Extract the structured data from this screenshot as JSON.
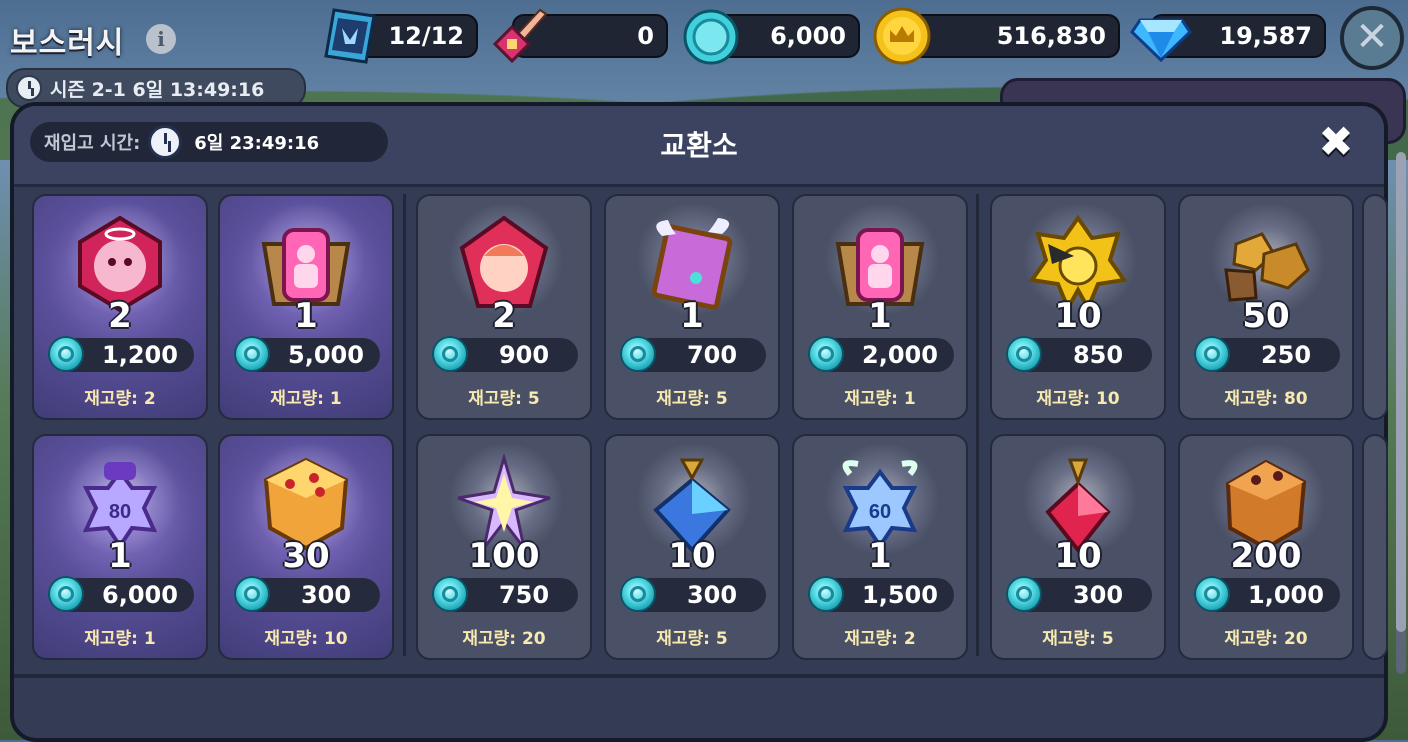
{
  "header": {
    "title": "보스러시",
    "season_text": "시즌 2-1  6일 13:49:16",
    "resources": [
      {
        "name": "ticket",
        "value": "12/12",
        "icon": "dragon-ticket-icon"
      },
      {
        "name": "sword",
        "value": "0",
        "icon": "sword-icon"
      },
      {
        "name": "boss-coin",
        "value": "6,000",
        "icon": "cyan-coin-icon"
      },
      {
        "name": "gold",
        "value": "516,830",
        "icon": "gold-crown-coin-icon"
      },
      {
        "name": "crystal",
        "value": "19,587",
        "icon": "diamond-icon"
      }
    ],
    "close_glyph": "✕"
  },
  "modal": {
    "restock_label": "재입고 시간:",
    "restock_time": "6일 23:49:16",
    "title": "교환소",
    "close_glyph": "✖"
  },
  "items": [
    {
      "icon": "pink-cookie-gem-icon",
      "qty": "2",
      "price": "1,200",
      "stock": "재고량: 2",
      "highlight": true
    },
    {
      "icon": "cookie-soulstone-chest-icon",
      "qty": "1",
      "price": "5,000",
      "stock": "재고량: 1",
      "highlight": true
    },
    {
      "icon": "red-cookie-gem-icon",
      "qty": "2",
      "price": "900",
      "stock": "재고량: 5",
      "highlight": false
    },
    {
      "icon": "winged-frame-icon",
      "qty": "1",
      "price": "700",
      "stock": "재고량: 5",
      "highlight": false
    },
    {
      "icon": "cookie-soulstone-chest-icon",
      "qty": "1",
      "price": "2,000",
      "stock": "재고량: 1",
      "highlight": false
    },
    {
      "icon": "golden-emblem-icon",
      "qty": "10",
      "price": "850",
      "stock": "재고량: 10",
      "highlight": false
    },
    {
      "icon": "gold-ore-icon",
      "qty": "50",
      "price": "250",
      "stock": "재고량: 80",
      "highlight": false
    },
    {
      "icon": "level-80-potion-icon",
      "qty": "1",
      "price": "6,000",
      "stock": "재고량: 1",
      "highlight": true
    },
    {
      "icon": "jelly-cube-icon",
      "qty": "30",
      "price": "300",
      "stock": "재고량: 10",
      "highlight": true
    },
    {
      "icon": "rainbow-star-icon",
      "qty": "100",
      "price": "750",
      "stock": "재고량: 20",
      "highlight": false
    },
    {
      "icon": "blue-crystal-potion-icon",
      "qty": "10",
      "price": "300",
      "stock": "재고량: 5",
      "highlight": false
    },
    {
      "icon": "level-60-potion-icon",
      "qty": "1",
      "price": "1,500",
      "stock": "재고량: 2",
      "highlight": false
    },
    {
      "icon": "red-crystal-potion-icon",
      "qty": "10",
      "price": "300",
      "stock": "재고량: 5",
      "highlight": false
    },
    {
      "icon": "orange-ore-icon",
      "qty": "200",
      "price": "1,000",
      "stock": "재고량: 20",
      "highlight": false
    }
  ],
  "colors": {
    "modal_bg": "#343b55",
    "card_bg": "#4a5166",
    "card_highlight": "#5a4f9a",
    "stock_text": "#f7e9b0",
    "coin": "#5fe1e8"
  }
}
